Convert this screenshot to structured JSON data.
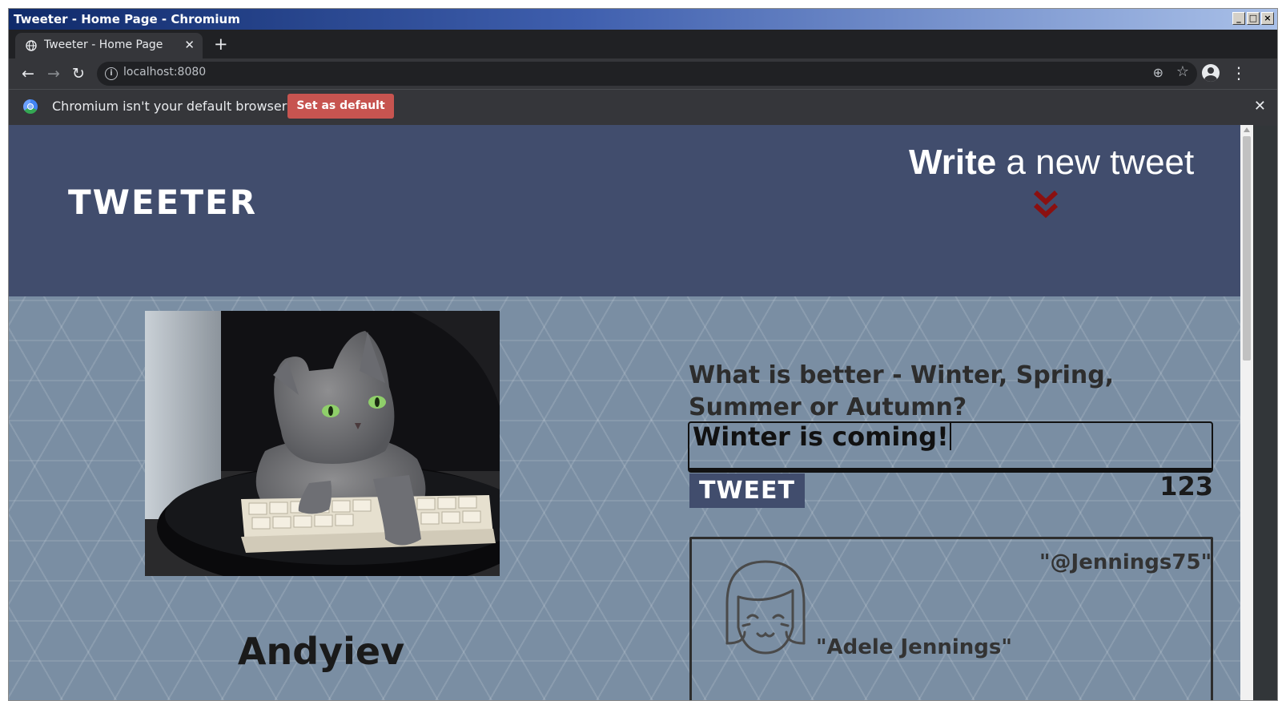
{
  "window": {
    "title": "Tweeter - Home Page - Chromium"
  },
  "browser": {
    "tab_title": "Tweeter - Home Page",
    "new_tab_symbol": "+",
    "url": "localhost:8080",
    "infobar": {
      "message": "Chromium isn't your default browser",
      "button_label": "Set as default"
    }
  },
  "page": {
    "logo": "Tweeter",
    "write_bold": "Write",
    "write_rest": " a new tweet",
    "user": {
      "name": "Andyiev"
    },
    "composer": {
      "question": "What is better - Winter, Spring, Summer or Autumn?",
      "text": "Winter is coming!",
      "button_label": "Tweet",
      "counter": "123"
    },
    "tweets": [
      {
        "handle": "\"@Jennings75\"",
        "name": "\"Adele Jennings\""
      }
    ]
  },
  "colors": {
    "header_bg": "#414d6d",
    "page_bg": "#7a8ea3",
    "chevron": "#8b1010",
    "default_button": "#c75450"
  }
}
